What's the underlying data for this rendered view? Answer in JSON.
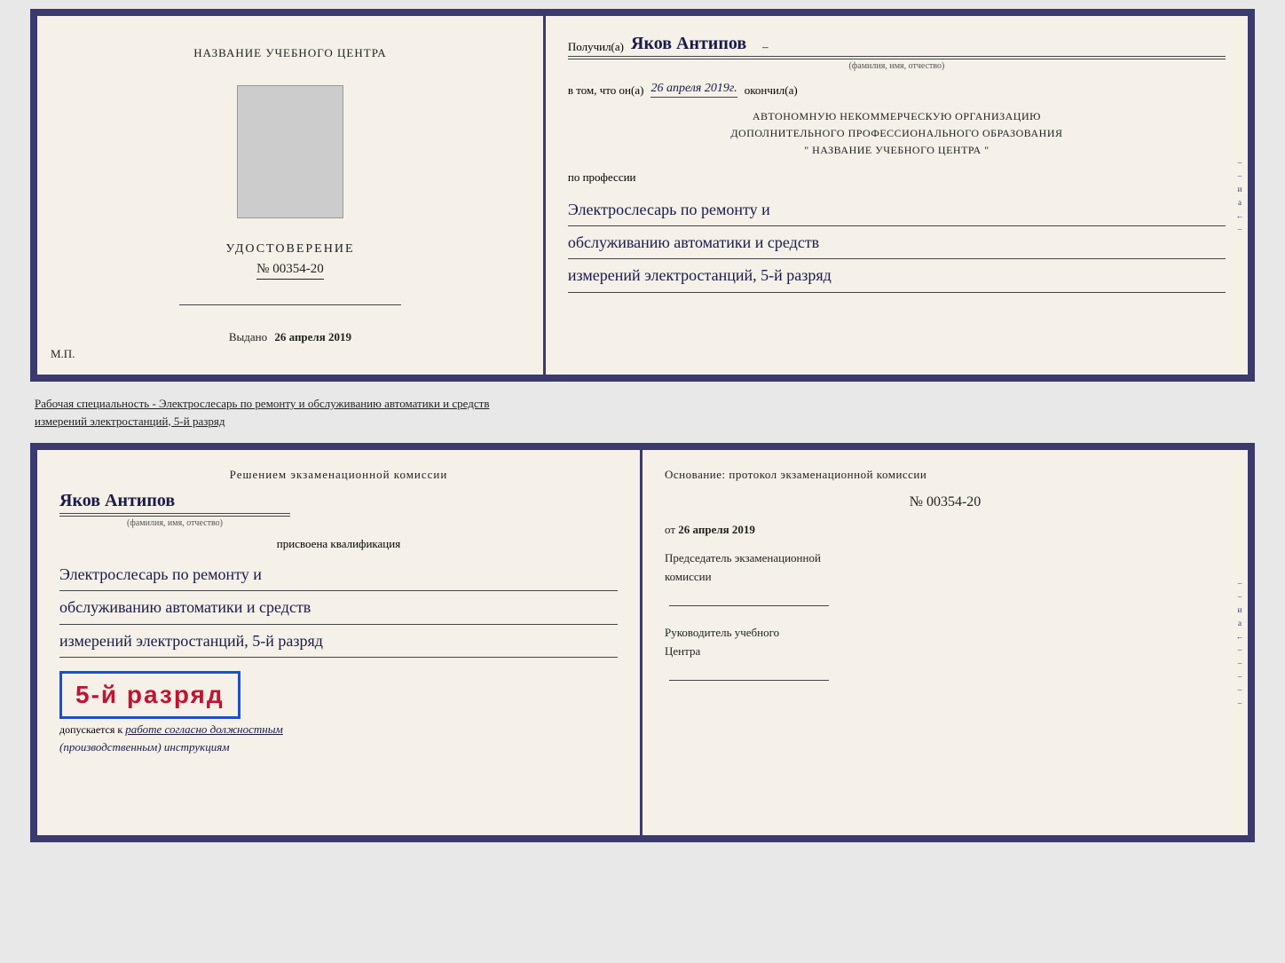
{
  "top_doc": {
    "left": {
      "center_title": "НАЗВАНИЕ УЧЕБНОГО ЦЕНТРА",
      "photo_alt": "фото",
      "udost_title": "УДОСТОВЕРЕНИЕ",
      "udost_number": "№ 00354-20",
      "vydano_label": "Выдано",
      "vydano_date": "26 апреля 2019",
      "mp_label": "М.П."
    },
    "right": {
      "poluchil_label": "Получил(а)",
      "recipient_name": "Яков Антипов",
      "fio_sublabel": "(фамилия, имя, отчество)",
      "vtom_label": "в том, что он(а)",
      "vtom_date": "26 апреля 2019г.",
      "okonchil_label": "окончил(а)",
      "org_line1": "АВТОНОМНУЮ НЕКОММЕРЧЕСКУЮ ОРГАНИЗАЦИЮ",
      "org_line2": "ДОПОЛНИТЕЛЬНОГО ПРОФЕССИОНАЛЬНОГО ОБРАЗОВАНИЯ",
      "org_line3": "\"   НАЗВАНИЕ УЧЕБНОГО ЦЕНТРА   \"",
      "po_professii_label": "по профессии",
      "profession_line1": "Электрослесарь по ремонту и",
      "profession_line2": "обслуживанию автоматики и средств",
      "profession_line3": "измерений электростанций, 5-й разряд"
    }
  },
  "divider": {
    "text": "Рабочая специальность - Электрослесарь по ремонту и обслуживанию автоматики и средств",
    "text2": "измерений электростанций, 5-й разряд"
  },
  "bottom_doc": {
    "left": {
      "commission_title": "Решением экзаменационной комиссии",
      "name": "Яков Антипов",
      "fio_sublabel": "(фамилия, имя, отчество)",
      "prisvoena_label": "присвоена квалификация",
      "qual_line1": "Электрослесарь по ремонту и",
      "qual_line2": "обслуживанию автоматики и средств",
      "qual_line3": "измерений электростанций, 5-й разряд",
      "grade_text": "5-й разряд",
      "dopuskaetsya_label": "допускается к",
      "dopuskaetsya_value": "работе согласно должностным",
      "dopuskaetsya_value2": "(производственным) инструкциям"
    },
    "right": {
      "osnovanie_label": "Основание: протокол экзаменационной комиссии",
      "number_label": "№",
      "number_value": "00354-20",
      "ot_label": "от",
      "ot_date": "26 апреля 2019",
      "predsedatel_label": "Председатель экзаменационной",
      "predsedatel_label2": "комиссии",
      "rukovoditel_label": "Руководитель учебного",
      "rukovoditel_label2": "Центра"
    }
  },
  "side_marks": [
    "–",
    "–",
    "и",
    "а",
    "←",
    "–",
    "–",
    "–",
    "–",
    "–"
  ]
}
